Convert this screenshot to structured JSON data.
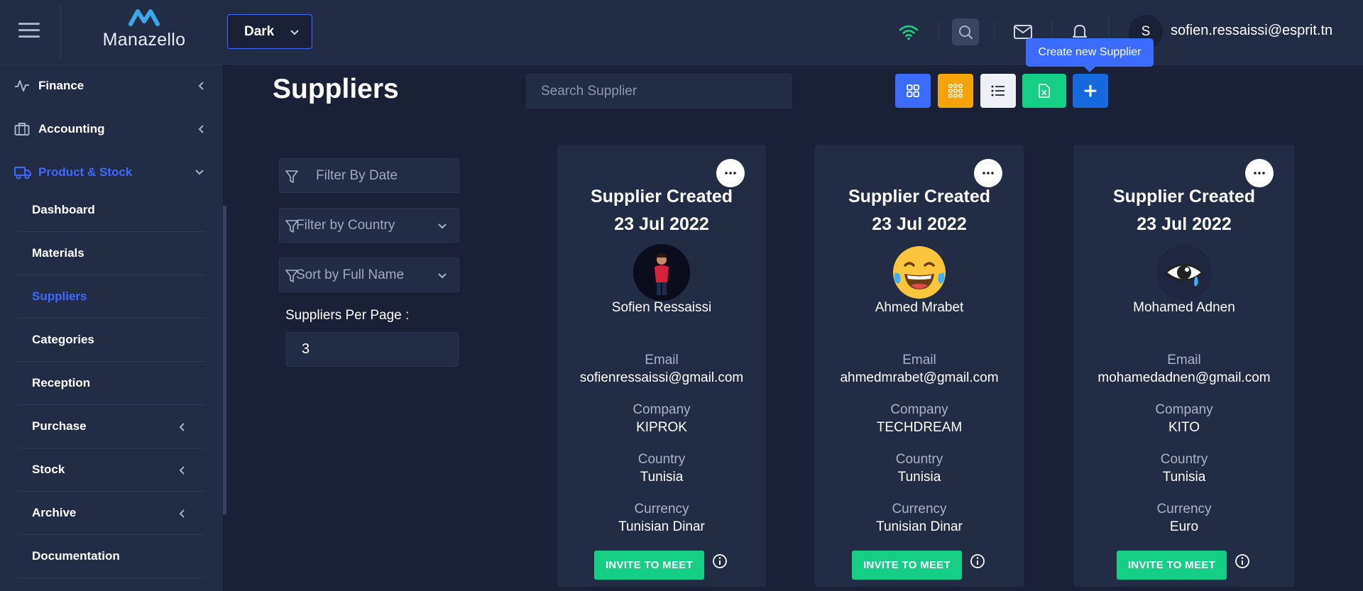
{
  "header": {
    "logo_text": "Manazello",
    "theme_select_value": "Dark",
    "avatar_initial": "S",
    "username": "sofien.ressaissi@esprit.tn",
    "tooltip": "Create new Supplier"
  },
  "sidebar": {
    "sections": [
      {
        "label": "Finance",
        "icon": "activity-icon"
      },
      {
        "label": "Accounting",
        "icon": "briefcase-icon"
      },
      {
        "label": "Product & Stock",
        "icon": "truck-icon"
      }
    ],
    "sub_items": [
      {
        "label": "Dashboard"
      },
      {
        "label": "Materials"
      },
      {
        "label": "Suppliers"
      },
      {
        "label": "Categories"
      },
      {
        "label": "Reception"
      },
      {
        "label": "Purchase"
      },
      {
        "label": "Stock"
      },
      {
        "label": "Archive"
      },
      {
        "label": "Documentation"
      }
    ]
  },
  "main": {
    "title": "Suppliers",
    "search_placeholder": "Search Supplier",
    "filters": {
      "date": "Filter By Date",
      "country": "Filter by Country",
      "sort": "Sort by Full Name"
    },
    "per_page_label": "Suppliers Per Page :",
    "per_page_value": "3",
    "view_buttons": [
      {
        "name": "grid-view-button",
        "color": "#3b6cff"
      },
      {
        "name": "compact-grid-button",
        "color": "#f5a30a"
      },
      {
        "name": "list-view-button",
        "color": "#eef0f6"
      },
      {
        "name": "export-excel-button",
        "color": "#15cf86"
      },
      {
        "name": "add-supplier-button",
        "color": "#1769e0"
      }
    ]
  },
  "suppliers": [
    {
      "title": "Supplier Created",
      "date": "23 Jul 2022",
      "name": "Sofien Ressaissi",
      "email_label": "Email",
      "email": "sofienressaissi@gmail.com",
      "company_label": "Company",
      "company": "KIPROK",
      "country_label": "Country",
      "country": "Tunisia",
      "currency_label": "Currency",
      "currency": "Tunisian Dinar",
      "invite": "INVITE TO MEET"
    },
    {
      "title": "Supplier Created",
      "date": "23 Jul 2022",
      "name": "Ahmed Mrabet",
      "email_label": "Email",
      "email": "ahmedmrabet@gmail.com",
      "company_label": "Company",
      "company": "TECHDREAM",
      "country_label": "Country",
      "country": "Tunisia",
      "currency_label": "Currency",
      "currency": "Tunisian Dinar",
      "invite": "INVITE TO MEET"
    },
    {
      "title": "Supplier Created",
      "date": "23 Jul 2022",
      "name": "Mohamed Adnen",
      "email_label": "Email",
      "email": "mohamedadnen@gmail.com",
      "company_label": "Company",
      "company": "KITO",
      "country_label": "Country",
      "country": "Tunisia",
      "currency_label": "Currency",
      "currency": "Euro",
      "invite": "INVITE TO MEET"
    }
  ]
}
